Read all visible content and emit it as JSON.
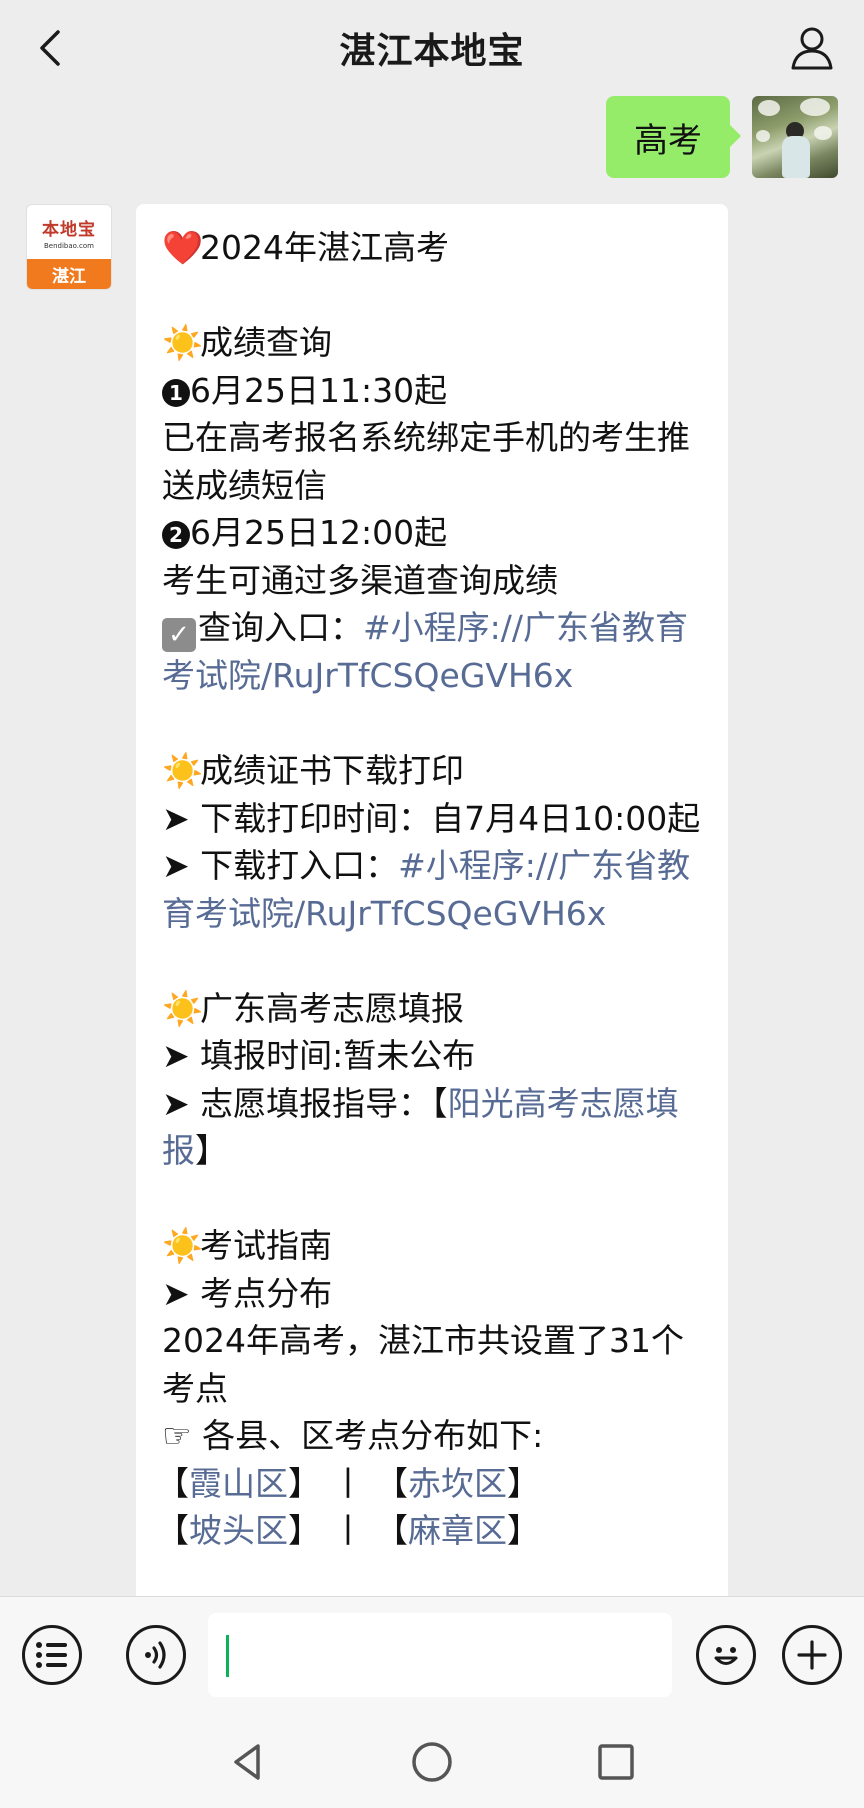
{
  "header": {
    "title": "湛江本地宝",
    "back_icon": "chevron-left-icon",
    "profile_icon": "person-icon"
  },
  "outgoing": {
    "text": "高考",
    "bubble_color": "#95ec69"
  },
  "bot_avatar": {
    "logo_text": "本地宝",
    "logo_url": "Bendibao.com",
    "city": "湛江"
  },
  "message": {
    "title": "2024年湛江高考",
    "sec1": {
      "heading": "成绩查询",
      "item1_num": "❶",
      "item1_time": "6月25日11:30起",
      "item1_desc": "已在高考报名系统绑定手机的考生推送成绩短信",
      "item2_num": "❷",
      "item2_time": "6月25日12:00起",
      "item2_desc": "考生可通过多渠道查询成绩",
      "entry_label": "查询入口：",
      "entry_link": "#小程序://广东省教育考试院/RuJrTfCSQeGVH6x"
    },
    "sec2": {
      "heading": "成绩证书下载打印",
      "time_label": "下载打印时间：自7月4日10:00起",
      "entry_label": "下载打入口：",
      "entry_link": "#小程序://广东省教育考试院/RuJrTfCSQeGVH6x"
    },
    "sec3": {
      "heading": "广东高考志愿填报",
      "time_label": "填报时间:暂未公布",
      "guide_label": "志愿填报指导：",
      "guide_open": "【",
      "guide_link": "阳光高考志愿填报",
      "guide_close": "】"
    },
    "sec4": {
      "heading": "考试指南",
      "sub": "考点分布",
      "desc": "2024年高考，湛江市共设置了31个考点",
      "list_intro": "各县、区考点分布如下:",
      "districts": [
        "霞山区",
        "赤坎区",
        "坡头区",
        "麻章区"
      ],
      "separator": "丨"
    }
  },
  "input_bar": {
    "placeholder": "",
    "list_icon": "list-menu-icon",
    "voice_icon": "voice-icon",
    "emoji_icon": "emoji-icon",
    "plus_icon": "plus-icon"
  },
  "nav": {
    "back_icon": "nav-back-icon",
    "home_icon": "nav-home-icon",
    "recents_icon": "nav-recents-icon"
  },
  "colors": {
    "link": "#576b95",
    "background": "#ededed",
    "cursor": "#08b35a"
  }
}
